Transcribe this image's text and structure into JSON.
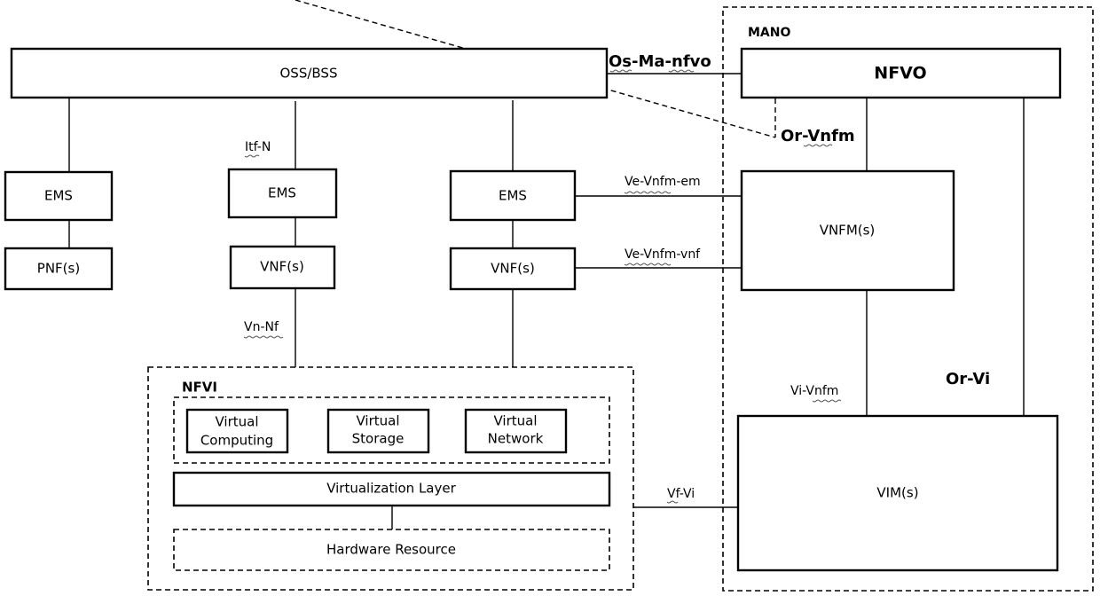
{
  "diagram": {
    "nodes": {
      "oss_bss": "OSS/BSS",
      "ems_1": "EMS",
      "ems_2": "EMS",
      "ems_3": "EMS",
      "pnf": "PNF(s)",
      "vnf_1": "VNF(s)",
      "vnf_2": "VNF(s)",
      "nfvo": "NFVO",
      "vnfm": "VNFM(s)",
      "vim": "VIM(s)",
      "virtual_computing_l1": "Virtual",
      "virtual_computing_l2": "Computing",
      "virtual_storage_l1": "Virtual",
      "virtual_storage_l2": "Storage",
      "virtual_network_l1": "Virtual",
      "virtual_network_l2": "Network",
      "virtualization_layer": "Virtualization Layer",
      "hardware_resource": "Hardware Resource"
    },
    "groups": {
      "mano": "MANO",
      "nfvi": "NFVI"
    },
    "interfaces": {
      "os_ma_nfvo": "Os-Ma-nfvo",
      "or_vnfm": "Or-Vnfm",
      "itf_n": "Itf-N",
      "ve_vnfm_em": "Ve-Vnfm-em",
      "ve_vnfm_vnf": "Ve-Vnfm-vnf",
      "vn_nf": "Vn-Nf",
      "vi_vnfm": "Vi-Vnfm",
      "or_vi": "Or-Vi",
      "vf_vi": "Vf-Vi"
    }
  }
}
